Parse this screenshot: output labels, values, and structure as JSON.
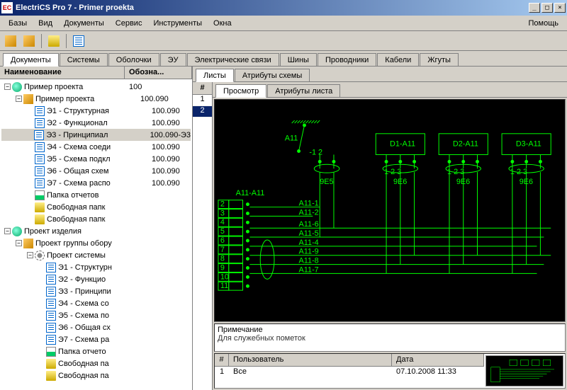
{
  "window": {
    "app_icon": "EC",
    "title": "ElectriCS Pro 7 - Primer proekta"
  },
  "menu": {
    "items": [
      "Базы",
      "Вид",
      "Документы",
      "Сервис",
      "Инструменты",
      "Окна"
    ],
    "help": "Помощь"
  },
  "main_tabs": [
    "Документы",
    "Системы",
    "Оболочки",
    "ЭУ",
    "Электрические связи",
    "Шины",
    "Проводники",
    "Кабели",
    "Жгуты"
  ],
  "main_tab_active": 0,
  "tree_cols": {
    "name": "Наименование",
    "code": "Обозна..."
  },
  "tree": [
    {
      "d": 0,
      "exp": "-",
      "icon": "globe",
      "name": "Пример проекта",
      "code": "100"
    },
    {
      "d": 1,
      "exp": "-",
      "icon": "box",
      "name": "Пример проекта",
      "code": "100.090"
    },
    {
      "d": 2,
      "exp": "",
      "icon": "doc",
      "name": "Э1 - Структурная",
      "code": "100.090"
    },
    {
      "d": 2,
      "exp": "",
      "icon": "doc",
      "name": "Э2 - Функционал",
      "code": "100.090"
    },
    {
      "d": 2,
      "exp": "",
      "icon": "doc",
      "name": "Э3 - Принципиал",
      "code": "100.090-Э3",
      "sel": true
    },
    {
      "d": 2,
      "exp": "",
      "icon": "doc",
      "name": "Э4 - Схема соеди",
      "code": "100.090"
    },
    {
      "d": 2,
      "exp": "",
      "icon": "doc",
      "name": "Э5 - Схема подкл",
      "code": "100.090"
    },
    {
      "d": 2,
      "exp": "",
      "icon": "doc",
      "name": "Э6 - Общая схем",
      "code": "100.090"
    },
    {
      "d": 2,
      "exp": "",
      "icon": "doc",
      "name": "Э7 - Схема распо",
      "code": "100.090"
    },
    {
      "d": 2,
      "exp": "",
      "icon": "report",
      "name": "Папка отчетов",
      "code": ""
    },
    {
      "d": 2,
      "exp": "",
      "icon": "folder",
      "name": "Свободная папк",
      "code": ""
    },
    {
      "d": 2,
      "exp": "",
      "icon": "folder",
      "name": "Свободная папк",
      "code": ""
    },
    {
      "d": 0,
      "exp": "-",
      "icon": "globe",
      "name": "Проект изделия",
      "code": ""
    },
    {
      "d": 1,
      "exp": "-",
      "icon": "box",
      "name": "Проект группы обору",
      "code": ""
    },
    {
      "d": 2,
      "exp": "-",
      "icon": "gear",
      "name": "Проект системы",
      "code": ""
    },
    {
      "d": 3,
      "exp": "",
      "icon": "doc",
      "name": "Э1 - Структурн",
      "code": ""
    },
    {
      "d": 3,
      "exp": "",
      "icon": "doc",
      "name": "Э2 - Функцио",
      "code": ""
    },
    {
      "d": 3,
      "exp": "",
      "icon": "doc",
      "name": "Э3 - Принципи",
      "code": ""
    },
    {
      "d": 3,
      "exp": "",
      "icon": "doc",
      "name": "Э4 - Схема со",
      "code": ""
    },
    {
      "d": 3,
      "exp": "",
      "icon": "doc",
      "name": "Э5 - Схема по",
      "code": ""
    },
    {
      "d": 3,
      "exp": "",
      "icon": "doc",
      "name": "Э6 - Общая сх",
      "code": ""
    },
    {
      "d": 3,
      "exp": "",
      "icon": "doc",
      "name": "Э7 - Схема ра",
      "code": ""
    },
    {
      "d": 3,
      "exp": "",
      "icon": "report",
      "name": "Папка отчето",
      "code": ""
    },
    {
      "d": 3,
      "exp": "",
      "icon": "folder",
      "name": "Свободная па",
      "code": ""
    },
    {
      "d": 3,
      "exp": "",
      "icon": "folder",
      "name": "Свободная па",
      "code": ""
    }
  ],
  "right_tabs": [
    "Листы",
    "Атрибуты схемы"
  ],
  "sheets_hash": "#",
  "sheets": [
    "1",
    "2"
  ],
  "sheet_selected": 1,
  "sub_tabs": [
    "Просмотр",
    "Атрибуты листа"
  ],
  "schematic": {
    "blocks": [
      "D1-A11",
      "D2-A11",
      "D3-A11"
    ],
    "switch": "A11",
    "terminal_labels": [
      "9E5",
      "9E6",
      "9E6",
      "9E6"
    ],
    "rows": [
      "2",
      "3",
      "4",
      "5",
      "6",
      "7",
      "8",
      "9",
      "10",
      "11"
    ],
    "nets": [
      "A11-1",
      "A11-2",
      "A11-6",
      "A11-5",
      "A11-4",
      "A11-9",
      "A11-8",
      "A11-7"
    ],
    "header_label": "A11-A11"
  },
  "notes": {
    "heading": "Примечание",
    "text": "Для служебных пометок"
  },
  "users": {
    "cols": [
      "#",
      "Пользователь",
      "Дата"
    ],
    "rows": [
      {
        "n": "1",
        "user": "Все",
        "date": "07.10.2008 11:33"
      }
    ]
  }
}
